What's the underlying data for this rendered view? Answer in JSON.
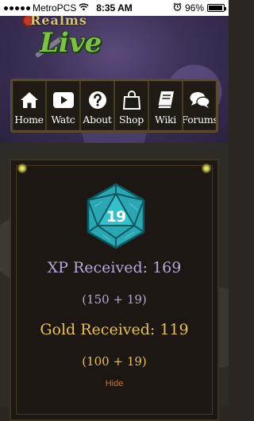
{
  "status_bar": {
    "carrier": "MetroPCS",
    "time": "8:35 AM",
    "battery": "96%",
    "battery_level": 0.96
  },
  "header": {
    "logo_top": "Realms",
    "logo_main": "Live"
  },
  "nav": {
    "items": [
      {
        "label": "Home",
        "icon": "home-icon"
      },
      {
        "label": "Watc",
        "icon": "play-icon"
      },
      {
        "label": "About",
        "icon": "question-icon"
      },
      {
        "label": "Shop",
        "icon": "shopping-bag-icon"
      },
      {
        "label": "Wiki",
        "icon": "book-icon"
      },
      {
        "label": "Forums",
        "icon": "chat-icon"
      }
    ]
  },
  "reward": {
    "die_value": "19",
    "xp_label": "XP Received:",
    "xp_value": "169",
    "xp_breakdown": "(150 + 19)",
    "gold_label": "Gold Received:",
    "gold_value": "119",
    "gold_breakdown": "(100 + 19)",
    "hide_label": "Hide"
  },
  "colors": {
    "xp_text": "#b8a8d8",
    "gold_text": "#e8c050",
    "hide_link": "#c8732e",
    "die": "#2aa7b3"
  }
}
